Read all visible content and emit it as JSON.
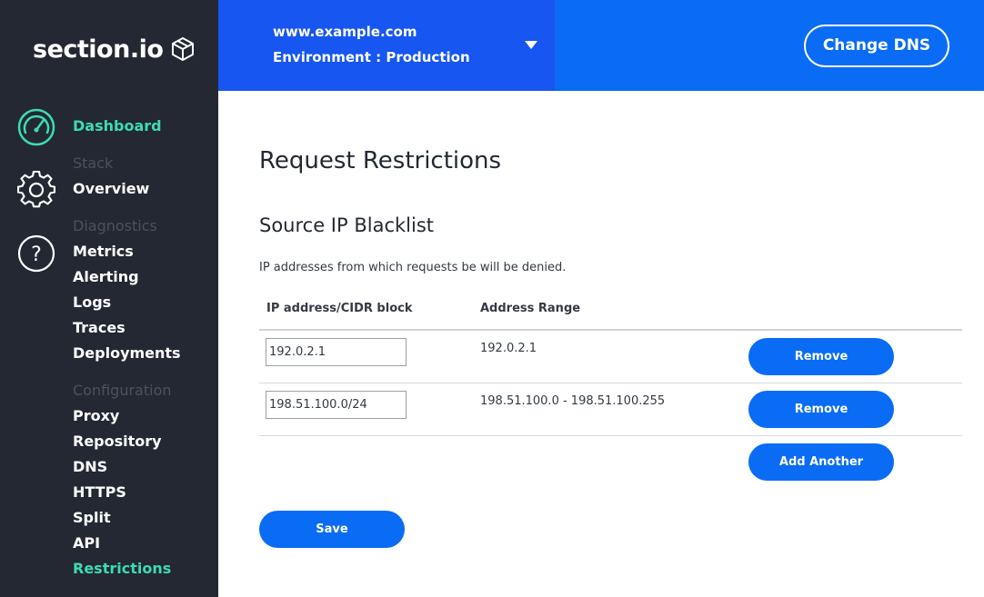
{
  "brand": {
    "name": "section.io"
  },
  "sidebar": {
    "dashboard": "Dashboard",
    "stack_heading": "Stack",
    "overview": "Overview",
    "diagnostics_heading": "Diagnostics",
    "diagnostics_items": [
      "Metrics",
      "Alerting",
      "Logs",
      "Traces",
      "Deployments"
    ],
    "configuration_heading": "Configuration",
    "configuration_items": [
      "Proxy",
      "Repository",
      "DNS",
      "HTTPS",
      "Split",
      "API",
      "Restrictions"
    ],
    "active_item": "Restrictions",
    "icons": [
      "speedometer-icon",
      "gear-icon",
      "help-icon"
    ]
  },
  "header": {
    "domain": "www.example.com",
    "environment": "Environment : Production",
    "change_dns_label": "Change DNS"
  },
  "main": {
    "page_title": "Request Restrictions",
    "section_title": "Source IP Blacklist",
    "section_description": "IP addresses from which requests be will be denied.",
    "columns": [
      "IP address/CIDR block",
      "Address Range"
    ],
    "rows": [
      {
        "ip": "192.0.2.1",
        "range": "192.0.2.1",
        "action": "Remove"
      },
      {
        "ip": "198.51.100.0/24",
        "range": "198.51.100.0 - 198.51.100.255",
        "action": "Remove"
      }
    ],
    "add_another_label": "Add Another",
    "save_label": "Save"
  },
  "colors": {
    "sidebar_bg": "#232833",
    "accent_teal": "#3ddbb3",
    "header_blue": "#0a6cf5",
    "env_panel_blue": "#1756f0",
    "button_blue": "#0a6cf5"
  }
}
